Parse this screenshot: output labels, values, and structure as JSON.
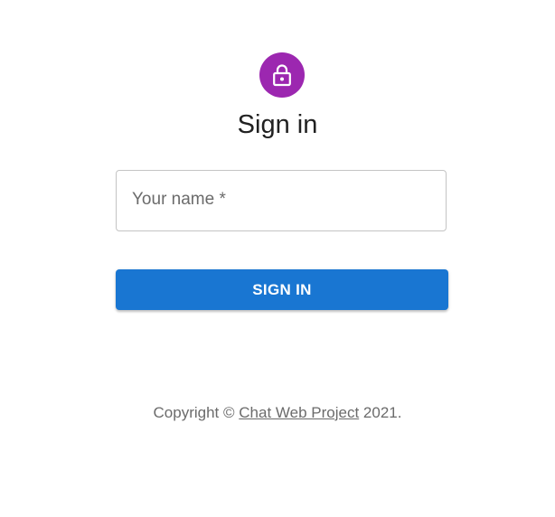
{
  "header": {
    "avatar_icon": "lock-icon",
    "avatar_color": "#9c27b0",
    "title": "Sign in"
  },
  "form": {
    "name_label": "Your name *",
    "name_value": "",
    "submit_label": "SIGN IN",
    "submit_color": "#1976d2"
  },
  "footer": {
    "prefix": "Copyright ©",
    "link_text": "Chat Web Project",
    "year": "2021."
  }
}
